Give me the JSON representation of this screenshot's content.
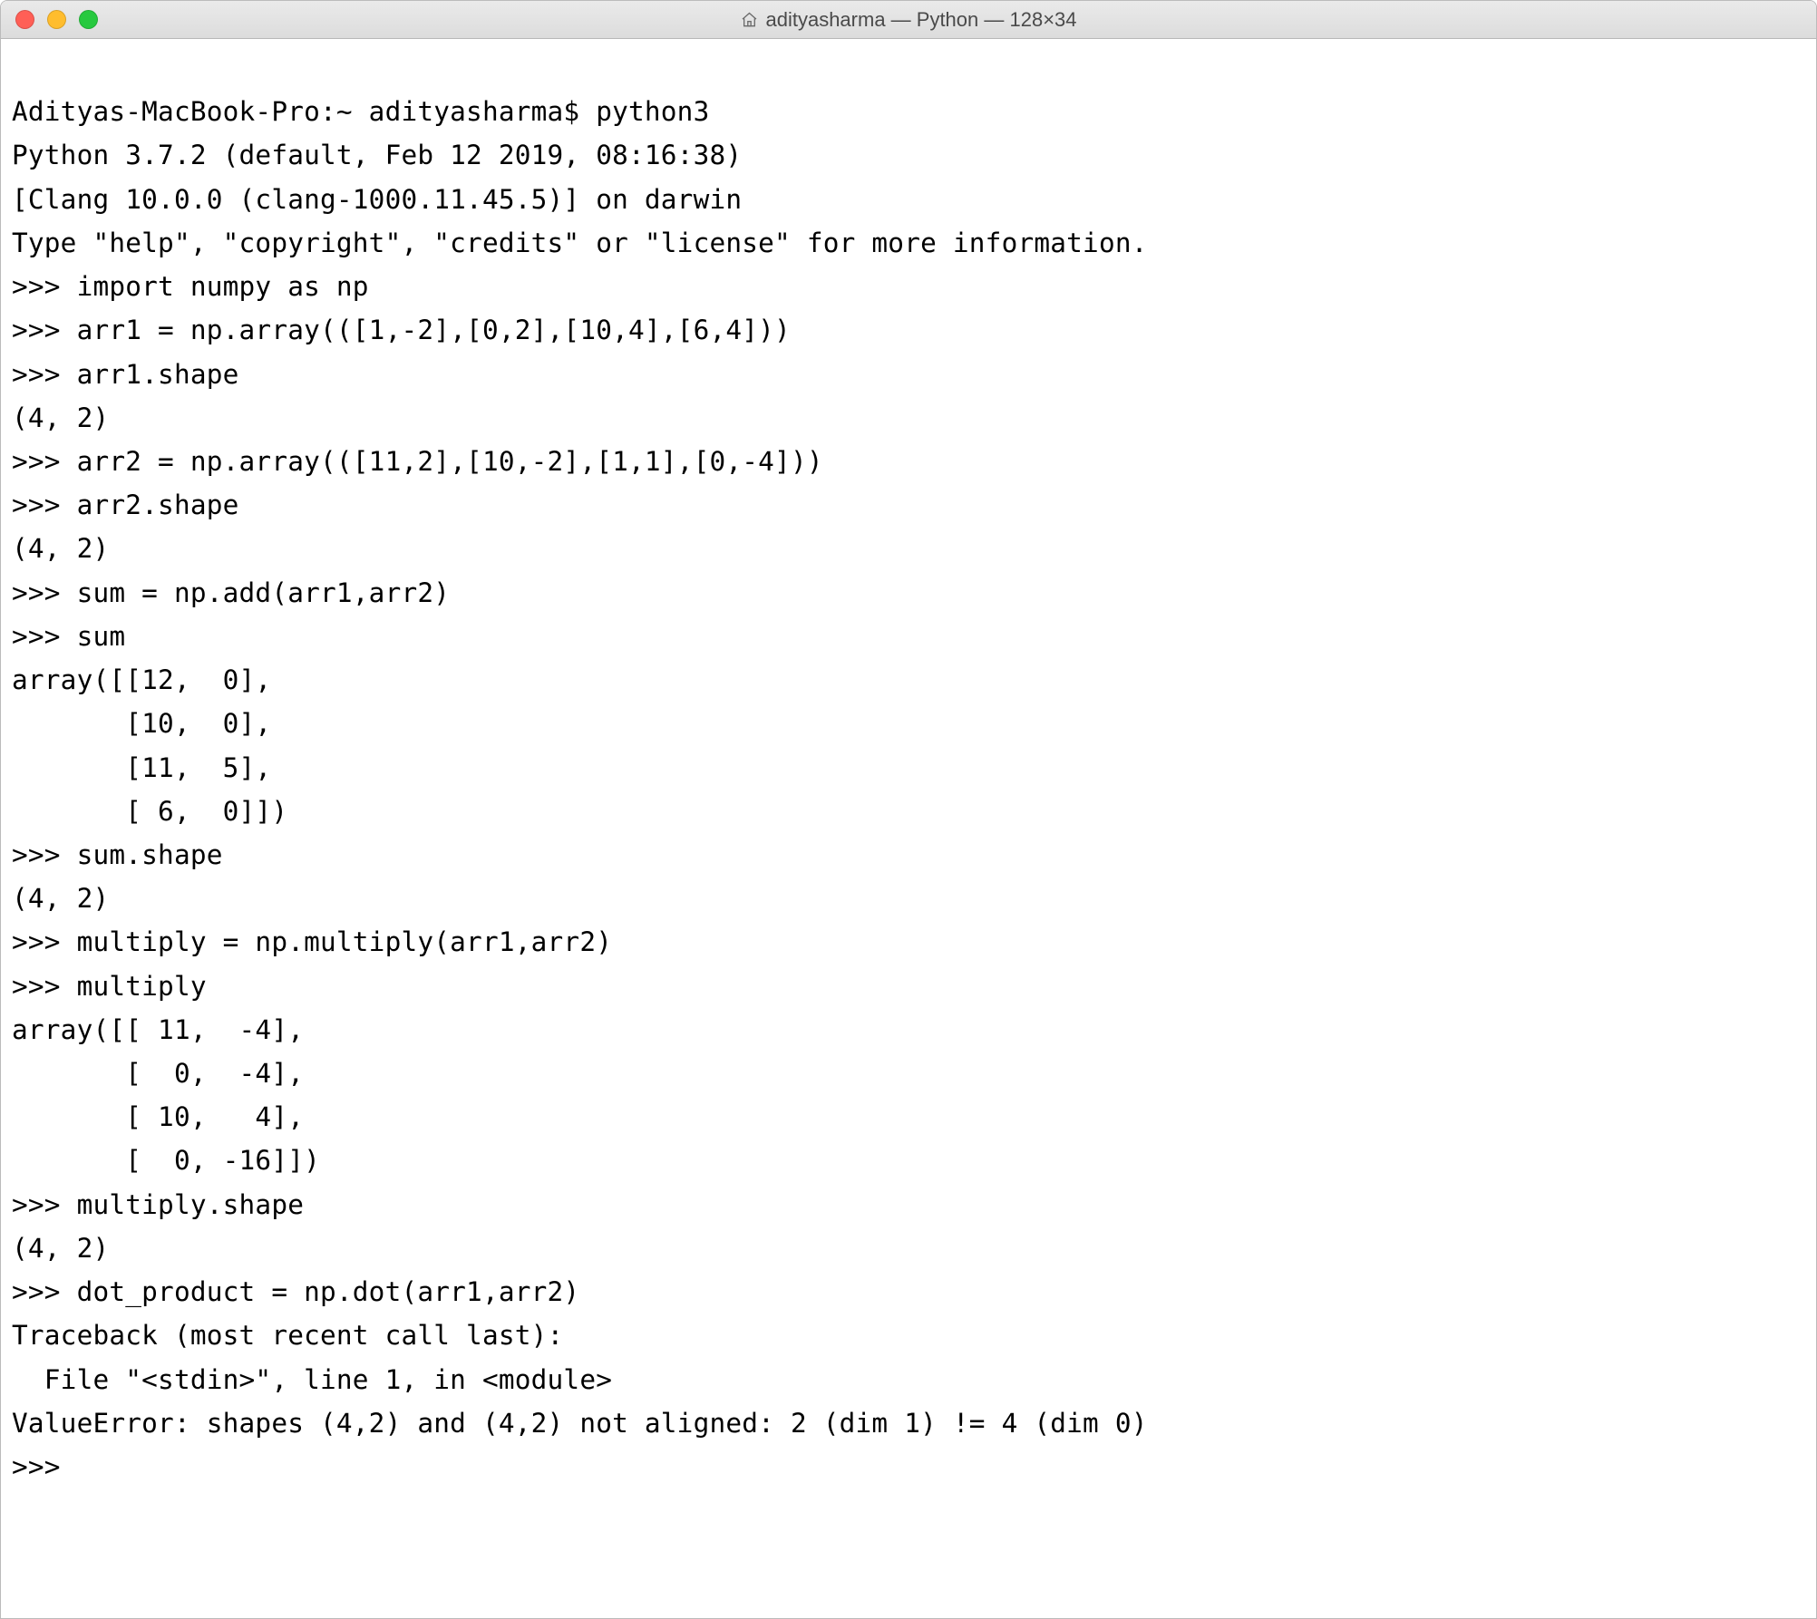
{
  "titlebar": {
    "title": "adityasharma — Python — 128×34"
  },
  "terminal": {
    "lines": [
      "",
      "Adityas-MacBook-Pro:~ adityasharma$ python3",
      "Python 3.7.2 (default, Feb 12 2019, 08:16:38) ",
      "[Clang 10.0.0 (clang-1000.11.45.5)] on darwin",
      "Type \"help\", \"copyright\", \"credits\" or \"license\" for more information.",
      ">>> import numpy as np",
      ">>> arr1 = np.array(([1,-2],[0,2],[10,4],[6,4]))",
      ">>> arr1.shape",
      "(4, 2)",
      ">>> arr2 = np.array(([11,2],[10,-2],[1,1],[0,-4]))",
      ">>> arr2.shape",
      "(4, 2)",
      ">>> sum = np.add(arr1,arr2)",
      ">>> sum",
      "array([[12,  0],",
      "       [10,  0],",
      "       [11,  5],",
      "       [ 6,  0]])",
      ">>> sum.shape",
      "(4, 2)",
      ">>> multiply = np.multiply(arr1,arr2)",
      ">>> multiply",
      "array([[ 11,  -4],",
      "       [  0,  -4],",
      "       [ 10,   4],",
      "       [  0, -16]])",
      ">>> multiply.shape",
      "(4, 2)",
      ">>> dot_product = np.dot(arr1,arr2)",
      "Traceback (most recent call last):",
      "  File \"<stdin>\", line 1, in <module>",
      "ValueError: shapes (4,2) and (4,2) not aligned: 2 (dim 1) != 4 (dim 0)",
      ">>> "
    ]
  }
}
